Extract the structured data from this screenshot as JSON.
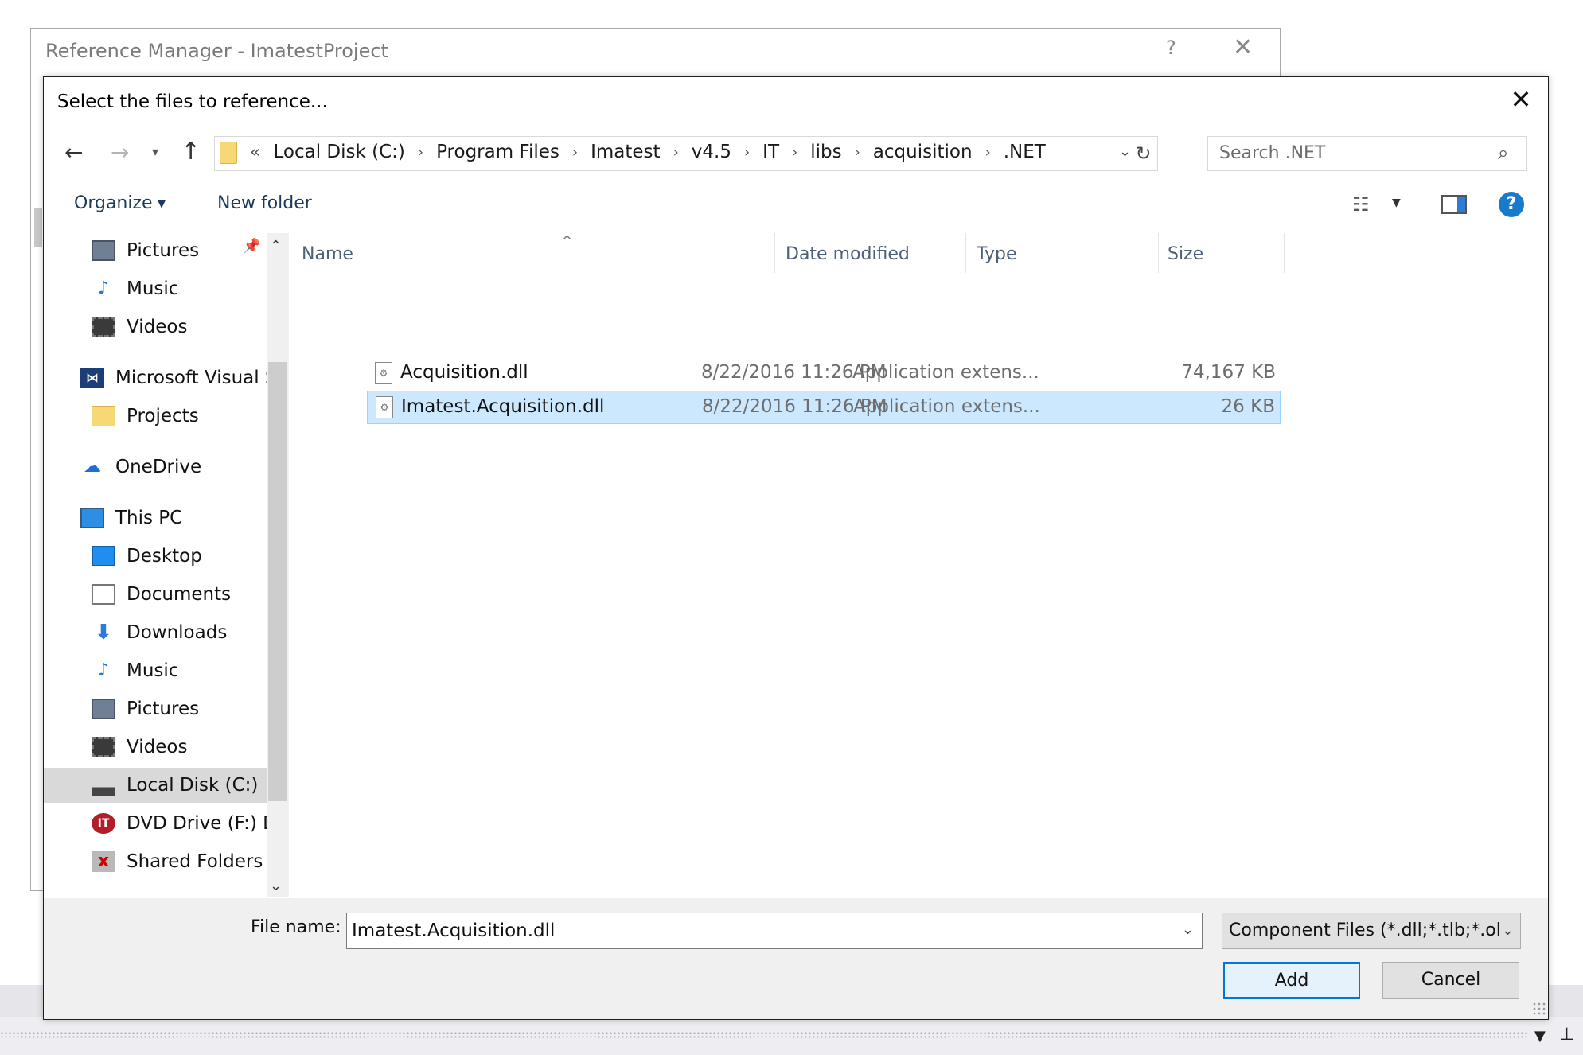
{
  "background_window": {
    "title": "Reference Manager - ImatestProject",
    "help_label": "?",
    "close_label": "✕"
  },
  "dialog": {
    "title": "Select the files to reference...",
    "close_label": "✕"
  },
  "address": {
    "lead": "«",
    "crumbs": [
      "Local Disk (C:)",
      "Program Files",
      "Imatest",
      "v4.5",
      "IT",
      "libs",
      "acquisition",
      ".NET"
    ]
  },
  "search": {
    "placeholder": "Search .NET"
  },
  "toolbar": {
    "organize": "Organize",
    "new_folder": "New folder"
  },
  "nav": {
    "items": [
      {
        "label": "Pictures",
        "icon": "pictures-icon"
      },
      {
        "label": "Music",
        "icon": "music-icon"
      },
      {
        "label": "Videos",
        "icon": "videos-icon"
      },
      {
        "label": "Microsoft Visual S",
        "icon": "visual-studio-icon"
      },
      {
        "label": "Projects",
        "icon": "folder-icon"
      },
      {
        "label": "OneDrive",
        "icon": "onedrive-icon"
      },
      {
        "label": "This PC",
        "icon": "this-pc-icon"
      },
      {
        "label": "Desktop",
        "icon": "desktop-icon"
      },
      {
        "label": "Documents",
        "icon": "documents-icon"
      },
      {
        "label": "Downloads",
        "icon": "downloads-icon"
      },
      {
        "label": "Music",
        "icon": "music-icon"
      },
      {
        "label": "Pictures",
        "icon": "pictures-icon"
      },
      {
        "label": "Videos",
        "icon": "videos-icon"
      },
      {
        "label": "Local Disk (C:)",
        "icon": "local-disk-icon",
        "selected": true
      },
      {
        "label": "DVD Drive (F:) D\\",
        "icon": "dvd-drive-icon"
      },
      {
        "label": "Shared Folders (\\",
        "icon": "shared-folders-icon"
      }
    ]
  },
  "files": {
    "columns": {
      "name": "Name",
      "date": "Date modified",
      "type": "Type",
      "size": "Size"
    },
    "rows": [
      {
        "name": "Acquisition.dll",
        "date": "8/22/2016 11:26 PM",
        "type": "Application extens...",
        "size": "74,167 KB",
        "selected": false
      },
      {
        "name": "Imatest.Acquisition.dll",
        "date": "8/22/2016 11:26 PM",
        "type": "Application extens...",
        "size": "26 KB",
        "selected": true
      }
    ]
  },
  "bottom": {
    "file_name_label": "File name:",
    "file_name_value": "Imatest.Acquisition.dll",
    "file_type": "Component Files (*.dll;*.tlb;*.ol",
    "add": "Add",
    "cancel": "Cancel"
  },
  "colors": {
    "selection": "#cce8ff",
    "accent": "#0078d7",
    "help": "#1979ca"
  }
}
